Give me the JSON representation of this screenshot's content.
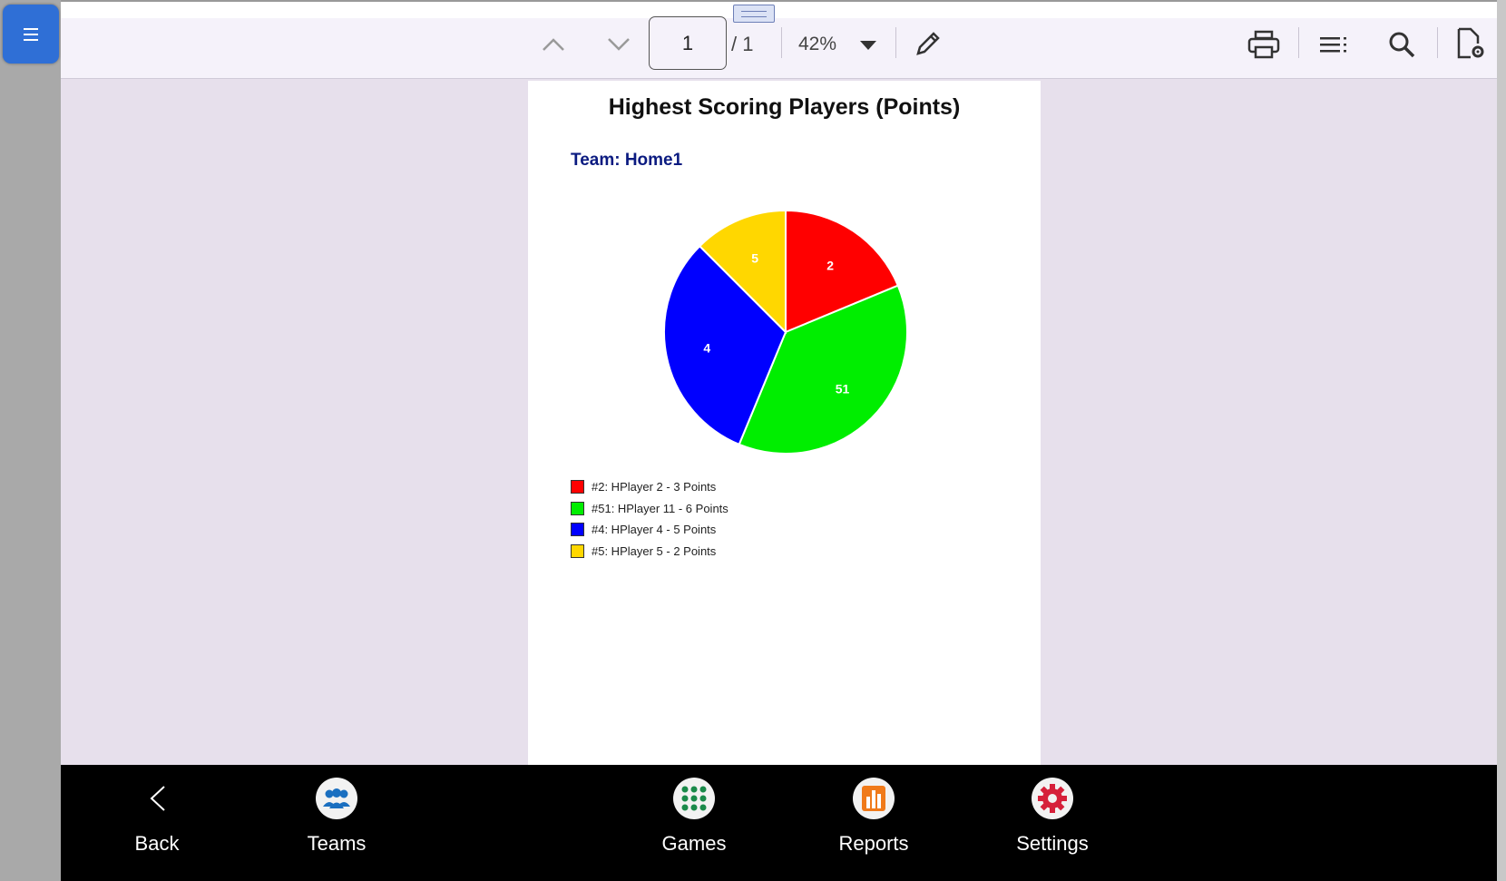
{
  "toolbar": {
    "page_number": "1",
    "page_total": "/ 1",
    "zoom": "42%"
  },
  "report": {
    "title": "Highest Scoring Players (Points)",
    "subtitle": "Team: Home1"
  },
  "chart_data": {
    "type": "pie",
    "title": "Highest Scoring Players (Points)",
    "subtitle": "Team: Home1",
    "slices": [
      {
        "label": "2",
        "legend": "#2: HPlayer 2 - 3 Points",
        "value": 3,
        "color": "#ff0000"
      },
      {
        "label": "51",
        "legend": "#51: HPlayer 11 - 6 Points",
        "value": 6,
        "color": "#00ee00"
      },
      {
        "label": "4",
        "legend": "#4: HPlayer 4 - 5 Points",
        "value": 5,
        "color": "#0000ff"
      },
      {
        "label": "5",
        "legend": "#5: HPlayer 5 - 2 Points",
        "value": 2,
        "color": "#ffd700"
      }
    ],
    "legend_position": "bottom-left"
  },
  "nav": {
    "back": "Back",
    "teams": "Teams",
    "games": "Games",
    "reports": "Reports",
    "settings": "Settings"
  },
  "colors": {
    "menu_button": "#2f6fd6",
    "teams_icon": "#1a6fc0",
    "games_icon": "#1a8a4a",
    "reports_icon": "#f07a1a",
    "settings_icon": "#d6203a"
  }
}
